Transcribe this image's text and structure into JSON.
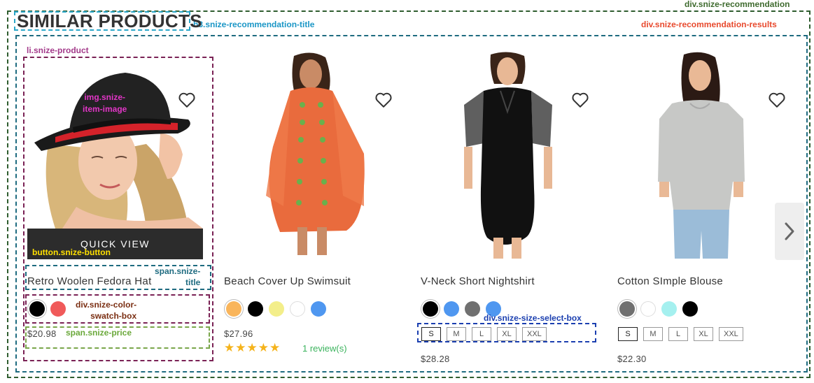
{
  "section": {
    "title": "SIMILAR PRODUCTS"
  },
  "annotations": {
    "recommendation": "div.snize-recommendation",
    "title": "h3.snize-recommendation-title",
    "results": "div.snize-recommendation-results",
    "product": "li.snize-product",
    "item_image": "img.snize-\nitem-image",
    "button": "button.snize-button",
    "span_title": "span.snize-\ntitle",
    "swatch_box": "div.snize-color-\nswatch-box",
    "price": "span.snize-price",
    "size_box": "div.snize-size-select-box"
  },
  "products": [
    {
      "title": "Retro Woolen Fedora Hat",
      "price": "$20.98",
      "quick_view": "QUICK VIEW",
      "swatches": [
        "#000000",
        "#f05a5a"
      ]
    },
    {
      "title": "Beach Cover Up Swimsuit",
      "price": "$27.96",
      "swatches": [
        "#f9b55b",
        "#000000",
        "#f3ee8a",
        "#ffffff",
        "#4f97f0"
      ],
      "rating_stars": "★★★★★",
      "reviews": "1 review(s)"
    },
    {
      "title": "V-Neck Short Nightshirt",
      "price": "$28.28",
      "swatches": [
        "#000000",
        "#4f97f0",
        "#707070",
        "#4f97f0"
      ],
      "sizes": [
        "S",
        "M",
        "L",
        "XL",
        "XXL"
      ]
    },
    {
      "title": "Cotton SImple Blouse",
      "price": "$22.30",
      "swatches": [
        "#707070",
        "#ffffff",
        "#a5f0ef",
        "#000000"
      ],
      "sizes": [
        "S",
        "M",
        "L",
        "XL",
        "XXL"
      ]
    }
  ],
  "icons": {
    "wishlist": "heart-icon",
    "next": "chevron-right-icon"
  }
}
